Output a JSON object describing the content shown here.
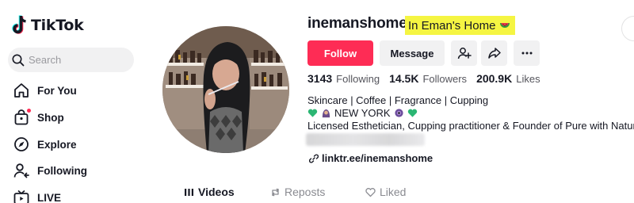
{
  "app": {
    "name": "TikTok"
  },
  "search": {
    "placeholder": "Search"
  },
  "sidebar": {
    "items": [
      {
        "label": "For You",
        "icon": "home-icon"
      },
      {
        "label": "Shop",
        "icon": "shopping-bag-icon",
        "has_notification_dot": true
      },
      {
        "label": "Explore",
        "icon": "compass-icon"
      },
      {
        "label": "Following",
        "icon": "following-user-icon"
      },
      {
        "label": "LIVE",
        "icon": "live-tv-icon"
      }
    ]
  },
  "profile": {
    "username": "inemanshome",
    "nickname": "In Eman's Home",
    "nickname_emoji": "watermelon-emoji",
    "buttons": {
      "follow": "Follow",
      "message": "Message"
    },
    "stats": [
      {
        "value": "3143",
        "label": "Following"
      },
      {
        "value": "14.5K",
        "label": "Followers"
      },
      {
        "value": "200.9K",
        "label": "Likes"
      }
    ],
    "bio": {
      "line1": "Skincare | Coffee | Fragrance | Cupping",
      "line2_text": "NEW YORK",
      "line2_emojis": [
        "green-heart-emoji",
        "woman-in-hijab-emoji",
        "purple-nazar-emoji",
        "green-heart-emoji"
      ],
      "line3": "Licensed Esthetician, Cupping practitioner & Founder of Pure with Nature"
    },
    "link": "linktr.ee/inemanshome"
  },
  "tabs": [
    {
      "label": "Videos",
      "active": true
    },
    {
      "label": "Reposts",
      "active": false
    },
    {
      "label": "Liked",
      "active": false
    }
  ],
  "colors": {
    "brand_red": "#fe2c55",
    "highlight_yellow": "#f5f542",
    "button_gray": "#f1f1f2",
    "text_primary": "#161823",
    "text_secondary": "#8a8b91"
  }
}
